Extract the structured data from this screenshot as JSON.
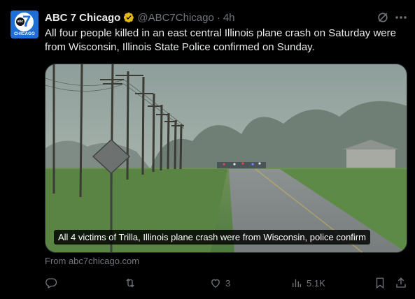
{
  "tweet": {
    "avatar": {
      "logo_mark": "abc",
      "logo_number": "7",
      "logo_city": "CHICAGO"
    },
    "display_name": "ABC 7 Chicago",
    "handle": "@ABC7Chicago",
    "separator": "·",
    "timestamp": "4h",
    "text": "All four people killed in an east central Illinois plane crash on Saturday were from Wisconsin, Illinois State Police confirmed on Sunday.",
    "media": {
      "caption": "All 4 victims of Trilla, Illinois plane crash were from Wisconsin, police confirm"
    },
    "source": "From abc7chicago.com",
    "metrics": {
      "replies": "",
      "reposts": "",
      "likes": "3",
      "views": "5.1K"
    }
  },
  "colors": {
    "background": "#000000",
    "text_primary": "#e7e9ea",
    "text_secondary": "#71767b",
    "verified_badge": "#e2b719",
    "brand_blue": "#1d6fd6"
  },
  "icons": [
    "verified-badge-icon",
    "grok-icon",
    "more-icon",
    "reply-icon",
    "repost-icon",
    "like-icon",
    "views-icon",
    "bookmark-icon",
    "share-icon"
  ]
}
